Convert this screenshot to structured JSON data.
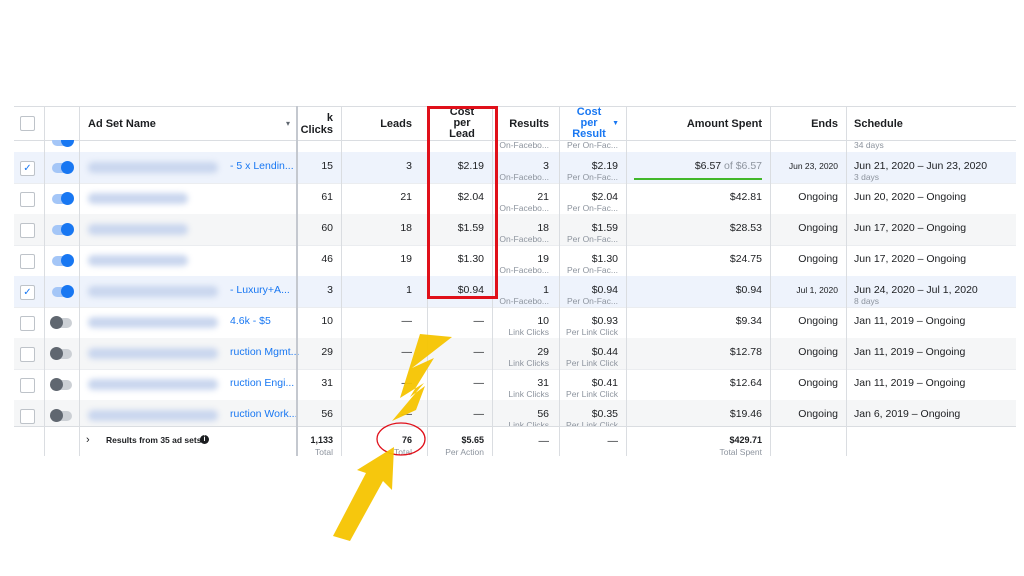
{
  "header": {
    "ad_set_name": "Ad Set Name",
    "link_clicks": "k Clicks",
    "leads": "Leads",
    "cost_per_lead": "Cost per Lead",
    "results": "Results",
    "cost_per_result": "Cost per Result",
    "amount_spent": "Amount Spent",
    "ends": "Ends",
    "schedule": "Schedule"
  },
  "top_partial": {
    "results_sub": "On-Facebo...",
    "cpr_sub": "Per On-Fac...",
    "schedule_sub": "34 days"
  },
  "rows": [
    {
      "selected": true,
      "toggle": "on",
      "name": "- 5 x Lendin...",
      "link_clicks": "15",
      "leads": "3",
      "cpl": "$2.19",
      "results": "3",
      "results_sub": "On-Facebo...",
      "cpr": "$2.19",
      "cpr_sub": "Per On-Fac...",
      "spent": "$6.57",
      "spent_of": "of $6.57",
      "spent_progress": 1.0,
      "ends": "Jun 23, 2020",
      "schedule": "Jun 21, 2020 – Jun 23, 2020",
      "schedule_sub": "3 days"
    },
    {
      "selected": false,
      "toggle": "on",
      "name": "",
      "link_clicks": "61",
      "leads": "21",
      "cpl": "$2.04",
      "results": "21",
      "results_sub": "On-Facebo...",
      "cpr": "$2.04",
      "cpr_sub": "Per On-Fac...",
      "spent": "$42.81",
      "ends": "Ongoing",
      "schedule": "Jun 20, 2020 – Ongoing"
    },
    {
      "selected": false,
      "toggle": "on",
      "name": "",
      "link_clicks": "60",
      "leads": "18",
      "cpl": "$1.59",
      "results": "18",
      "results_sub": "On-Facebo...",
      "cpr": "$1.59",
      "cpr_sub": "Per On-Fac...",
      "spent": "$28.53",
      "ends": "Ongoing",
      "schedule": "Jun 17, 2020 – Ongoing"
    },
    {
      "selected": false,
      "toggle": "on",
      "name": "",
      "link_clicks": "46",
      "leads": "19",
      "cpl": "$1.30",
      "results": "19",
      "results_sub": "On-Facebo...",
      "cpr": "$1.30",
      "cpr_sub": "Per On-Fac...",
      "spent": "$24.75",
      "ends": "Ongoing",
      "schedule": "Jun 17, 2020 – Ongoing"
    },
    {
      "selected": true,
      "toggle": "on",
      "name": "- Luxury+A...",
      "link_clicks": "3",
      "leads": "1",
      "cpl": "$0.94",
      "results": "1",
      "results_sub": "On-Facebo...",
      "cpr": "$0.94",
      "cpr_sub": "Per On-Fac...",
      "spent": "$0.94",
      "ends": "Jul 1, 2020",
      "schedule": "Jun 24, 2020 – Jul 1, 2020",
      "schedule_sub": "8 days"
    },
    {
      "selected": false,
      "toggle": "off",
      "name": "4.6k - $5",
      "link_clicks": "10",
      "leads": "—",
      "cpl": "—",
      "results": "10",
      "results_sub": "Link Clicks",
      "cpr": "$0.93",
      "cpr_sub": "Per Link Click",
      "spent": "$9.34",
      "ends": "Ongoing",
      "schedule": "Jan 11, 2019 – Ongoing"
    },
    {
      "selected": false,
      "toggle": "off",
      "name": "ruction Mgmt...",
      "link_clicks": "29",
      "leads": "—",
      "cpl": "—",
      "results": "29",
      "results_sub": "Link Clicks",
      "cpr": "$0.44",
      "cpr_sub": "Per Link Click",
      "spent": "$12.78",
      "ends": "Ongoing",
      "schedule": "Jan 11, 2019 – Ongoing"
    },
    {
      "selected": false,
      "toggle": "off",
      "name": "ruction Engi...",
      "link_clicks": "31",
      "leads": "—",
      "cpl": "—",
      "results": "31",
      "results_sub": "Link Clicks",
      "cpr": "$0.41",
      "cpr_sub": "Per Link Click",
      "spent": "$12.64",
      "ends": "Ongoing",
      "schedule": "Jan 11, 2019 – Ongoing"
    },
    {
      "selected": false,
      "toggle": "off",
      "name": "ruction Work...",
      "link_clicks": "56",
      "leads": "—",
      "cpl": "—",
      "results": "56",
      "results_sub": "Link Clicks",
      "cpr": "$0.35",
      "cpr_sub": "Per Link Click",
      "spent": "$19.46",
      "ends": "Ongoing",
      "schedule": "Jan 6, 2019 – Ongoing"
    }
  ],
  "footer": {
    "label": "Results from 35 ad sets",
    "link_clicks": "1,133",
    "link_clicks_sub": "Total",
    "leads": "76",
    "leads_sub": "Total",
    "cpl": "$5.65",
    "cpl_sub": "Per Action",
    "results": "—",
    "cpr": "—",
    "spent": "$429.71",
    "spent_sub": "Total Spent"
  },
  "colors": {
    "accent": "#1877f2",
    "highlight_box": "#e0101a",
    "arrow": "#f5c400",
    "progress": "#42b72a"
  }
}
